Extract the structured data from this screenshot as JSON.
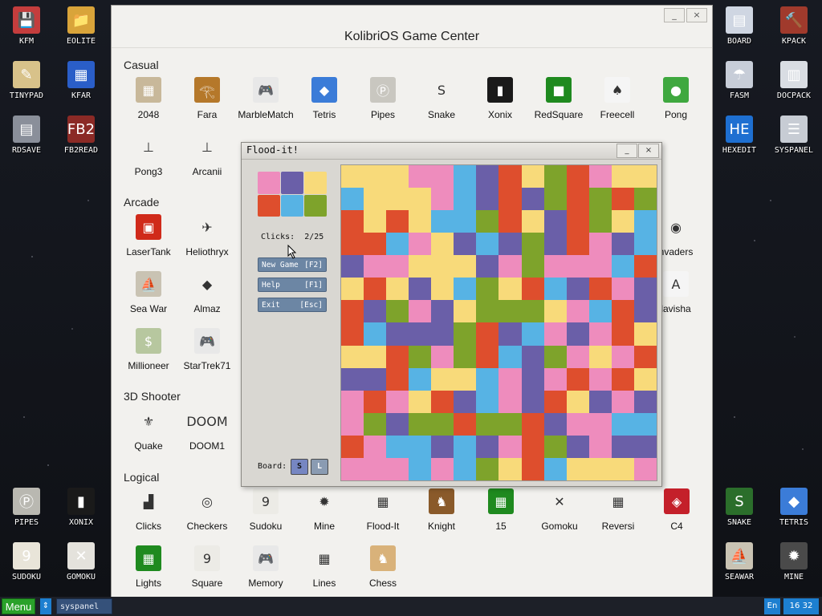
{
  "desktop_left": [
    {
      "label": "KFM",
      "icon": "floppy-icon",
      "color": "#c43d3d",
      "glyph": "💾"
    },
    {
      "label": "EOLITE",
      "icon": "folder-icon",
      "color": "#d9a43a",
      "glyph": "📁"
    },
    {
      "label": "TINYPAD",
      "icon": "notepad-icon",
      "color": "#d8c28a",
      "glyph": "✎"
    },
    {
      "label": "KFAR",
      "icon": "kfar-icon",
      "color": "#2a5ec8",
      "glyph": "▦"
    },
    {
      "label": "RDSAVE",
      "icon": "rdsave-icon",
      "color": "#8a8f9a",
      "glyph": "▤"
    },
    {
      "label": "FB2READ",
      "icon": "fb2-icon",
      "color": "#8b2a26",
      "glyph": "FB2"
    },
    {
      "label": "PIPES",
      "icon": "pipes-icon",
      "color": "#b9b8b1",
      "glyph": "Ⓟ"
    },
    {
      "label": "XONIX",
      "icon": "xonix-icon",
      "color": "#1a1a1a",
      "glyph": "▮"
    },
    {
      "label": "SUDOKU",
      "icon": "sudoku-icon",
      "color": "#e9e5d9",
      "glyph": "9"
    },
    {
      "label": "GOMOKU",
      "icon": "gomoku-icon",
      "color": "#e4e2dc",
      "glyph": "✕"
    }
  ],
  "desktop_right": [
    {
      "label": "BOARD",
      "icon": "board-icon",
      "color": "#cfd6e2",
      "glyph": "▤"
    },
    {
      "label": "KPACK",
      "icon": "kpack-icon",
      "color": "#a03a2c",
      "glyph": "🔨"
    },
    {
      "label": "FASM",
      "icon": "fasm-icon",
      "color": "#c7cdd8",
      "glyph": "☂"
    },
    {
      "label": "DOCPACK",
      "icon": "docpack-icon",
      "color": "#d9dde3",
      "glyph": "▥"
    },
    {
      "label": "HEXEDIT",
      "icon": "hexedit-icon",
      "color": "#1e6fd1",
      "glyph": "HE"
    },
    {
      "label": "SYSPANEL",
      "icon": "syspanel-icon",
      "color": "#c7ccd4",
      "glyph": "☰"
    },
    {
      "label": "SNAKE",
      "icon": "snake-icon",
      "color": "#2b6e2b",
      "glyph": "S"
    },
    {
      "label": "TETRIS",
      "icon": "tetris-icon",
      "color": "#3b7cd8",
      "glyph": "◆"
    },
    {
      "label": "SEAWAR",
      "icon": "seawar-icon",
      "color": "#c9c3b3",
      "glyph": "⛵"
    },
    {
      "label": "MINE",
      "icon": "mine-icon",
      "color": "#4a4a4a",
      "glyph": "✹"
    }
  ],
  "main_window": {
    "title": "KolibriOS Game Center",
    "minimize": "_",
    "close": "×",
    "categories": [
      "Casual",
      "Arcade",
      "3D Shooter",
      "Logical"
    ],
    "casual": [
      {
        "label": "2048",
        "icon": "2048-icon",
        "color": "#c8b89a",
        "glyph": "▦"
      },
      {
        "label": "Fara",
        "icon": "fara-icon",
        "color": "#b5782a",
        "glyph": "𓂀"
      },
      {
        "label": "MarbleMatch",
        "icon": "gamepad-icon",
        "color": "#e8e8e8",
        "glyph": "🎮"
      },
      {
        "label": "Tetris",
        "icon": "tetris-icon",
        "color": "#3b7cd8",
        "glyph": "◆"
      },
      {
        "label": "Pipes",
        "icon": "pipes-icon",
        "color": "#c9c7c0",
        "glyph": "Ⓟ"
      },
      {
        "label": "Snake",
        "icon": "snake-icon",
        "color": "#f2f1ee",
        "glyph": "S"
      },
      {
        "label": "Xonix",
        "icon": "xonix-icon",
        "color": "#1a1a1a",
        "glyph": "▮"
      },
      {
        "label": "RedSquare",
        "icon": "redsquare-icon",
        "color": "#1f8a1f",
        "glyph": "■"
      },
      {
        "label": "Freecell",
        "icon": "cards-icon",
        "color": "#f5f5f5",
        "glyph": "♠"
      },
      {
        "label": "Pong",
        "icon": "ball-icon",
        "color": "#3fa83f",
        "glyph": "●"
      },
      {
        "label": "Pong3",
        "icon": "pong3-icon",
        "color": "#f2f1ee",
        "glyph": "⊥"
      },
      {
        "label": "Arcanii",
        "icon": "arcanii-icon",
        "color": "#f2f1ee",
        "glyph": "⊥"
      }
    ],
    "arcade": [
      {
        "label": "LaserTank",
        "icon": "tank-icon",
        "color": "#d02a1a",
        "glyph": "▣"
      },
      {
        "label": "Heliothryx",
        "icon": "plane-icon",
        "color": "#f2f1ee",
        "glyph": "✈"
      },
      {
        "label": "Sea War",
        "icon": "ship-icon",
        "color": "#c9c3b3",
        "glyph": "⛵"
      },
      {
        "label": "Almaz",
        "icon": "diamond-icon",
        "color": "#f2f1ee",
        "glyph": "◆"
      },
      {
        "label": "Millioneer",
        "icon": "money-icon",
        "color": "#b7c79f",
        "glyph": "$"
      },
      {
        "label": "StarTrek71",
        "icon": "gamepad-icon",
        "color": "#e8e8e8",
        "glyph": "🎮"
      },
      {
        "label": "nvaders",
        "icon": "ufo-icon",
        "color": "#f2f1ee",
        "glyph": "◉"
      },
      {
        "label": "lavisha",
        "icon": "keyboard-icon",
        "color": "#f5f5f5",
        "glyph": "A"
      }
    ],
    "shooter": [
      {
        "label": "Quake",
        "icon": "quake-icon",
        "color": "#f2f1ee",
        "glyph": "⚜"
      },
      {
        "label": "DOOM1",
        "icon": "doom-icon",
        "color": "#f2f1ee",
        "glyph": "DOOM"
      }
    ],
    "logical": [
      {
        "label": "Clicks",
        "icon": "clicks-icon",
        "color": "#f2f1ee",
        "glyph": "▟"
      },
      {
        "label": "Checkers",
        "icon": "checkers-icon",
        "color": "#f2f1ee",
        "glyph": "◎"
      },
      {
        "label": "Sudoku",
        "icon": "sudoku-icon",
        "color": "#ecebe6",
        "glyph": "9"
      },
      {
        "label": "Mine",
        "icon": "mine-icon",
        "color": "#f2f1ee",
        "glyph": "✹"
      },
      {
        "label": "Flood-It",
        "icon": "floodit-icon",
        "color": "#f2f1ee",
        "glyph": "▦"
      },
      {
        "label": "Knight",
        "icon": "knight-icon",
        "color": "#8a5a2a",
        "glyph": "♞"
      },
      {
        "label": "15",
        "icon": "fifteen-icon",
        "color": "#1f8a1f",
        "glyph": "▦"
      },
      {
        "label": "Gomoku",
        "icon": "gomoku-icon",
        "color": "#f2f1ee",
        "glyph": "✕"
      },
      {
        "label": "Reversi",
        "icon": "reversi-icon",
        "color": "#f2f1ee",
        "glyph": "▦"
      },
      {
        "label": "C4",
        "icon": "c4-icon",
        "color": "#c4202a",
        "glyph": "◈"
      },
      {
        "label": "Lights",
        "icon": "lights-icon",
        "color": "#1f8a1f",
        "glyph": "▦"
      },
      {
        "label": "Square",
        "icon": "square-icon",
        "color": "#ecebe6",
        "glyph": "9"
      },
      {
        "label": "Memory",
        "icon": "gamepad-icon",
        "color": "#e8e8e8",
        "glyph": "🎮"
      },
      {
        "label": "Lines",
        "icon": "lines-icon",
        "color": "#f2f1ee",
        "glyph": "▦"
      },
      {
        "label": "Chess",
        "icon": "chess-icon",
        "color": "#d9b27a",
        "glyph": "♞"
      }
    ]
  },
  "flood_it": {
    "title": "Flood-it!",
    "minimize": "_",
    "close": "×",
    "palette": [
      "#ee8cbd",
      "#6a5fa8",
      "#f8da7a",
      "#de4e2d",
      "#57b3e4",
      "#7ea32b"
    ],
    "clicks_label": "Clicks:",
    "clicks_value": "2/25",
    "buttons": [
      {
        "label": "New Game",
        "key": "[F2]"
      },
      {
        "label": "Help",
        "key": "[F1]"
      },
      {
        "label": "Exit",
        "key": "[Esc]"
      }
    ],
    "board_label": "Board:",
    "size_small": "S",
    "size_large": "L",
    "colors": {
      "P": "#ee8cbd",
      "U": "#6a5fa8",
      "Y": "#f8da7a",
      "R": "#de4e2d",
      "B": "#57b3e4",
      "G": "#7ea32b"
    },
    "grid": [
      "YYYPPBURYGRPYY",
      "BYYYPBURUGRGRG",
      "RYRYBBGRYURGYB",
      "RRBPYUBUGURPUB",
      "UPPYYYUPGPPPBR",
      "YRYUYBGYRBURPU",
      "RUGPUYGGGYPBRU",
      "RBUUUGRUBPUPRY",
      "YYRGPGRBUGPYPR",
      "UURBYYBPUPRPRY",
      "PRPYRUBPURYUPU",
      "PGUGGRGGRUPPBB",
      "RPBBUBUPRGUPUU",
      "PPPBPBGYRBYYYP"
    ]
  },
  "taskbar": {
    "menu": "Menu",
    "switch_glyph": "⇕",
    "task": "syspanel",
    "lang": "En",
    "clock": "16 32"
  }
}
